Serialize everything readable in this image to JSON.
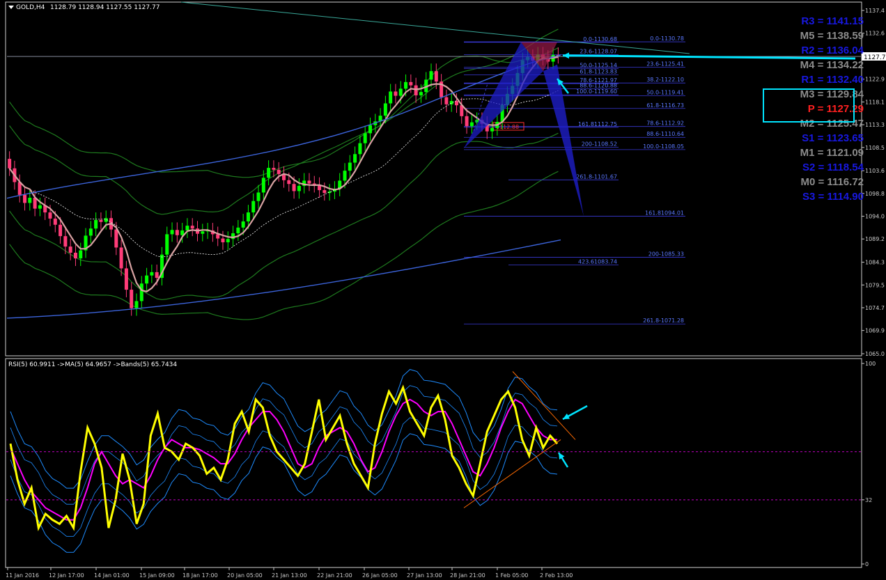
{
  "header": {
    "symbol": "GOLD,H4",
    "ohlc": "1128.79 1128.94 1127.55 1127.77",
    "rsi_label": "RSI(5) 60.9911  ->MA(5) 64.9657  ->Bands(5) 65.7434"
  },
  "price_axis": {
    "ticks": [
      "1137.4",
      "1132.6",
      "1127.7",
      "1122.9",
      "1118.1",
      "1113.3",
      "1108.5",
      "1103.6",
      "1098.8",
      "1094.0",
      "1089.2",
      "1084.3",
      "1079.5",
      "1074.7",
      "1069.9",
      "1065.0"
    ],
    "current": "1127.7"
  },
  "rsi_axis": {
    "ticks": [
      "100",
      "32",
      "0"
    ]
  },
  "time_axis": {
    "ticks": [
      "11 Jan 2016",
      "12 Jan 17:00",
      "14 Jan 01:00",
      "15 Jan 09:00",
      "18 Jan 17:00",
      "20 Jan 05:00",
      "21 Jan 13:00",
      "22 Jan 21:00",
      "26 Jan 05:00",
      "27 Jan 13:00",
      "28 Jan 21:00",
      "1 Feb 05:00",
      "2 Feb 13:00"
    ]
  },
  "pivots": [
    {
      "label": "R3 = 1141.15",
      "color": "#1818e0"
    },
    {
      "label": "M5 = 1138.59",
      "color": "#8c8c8c"
    },
    {
      "label": "R2 = 1136.04",
      "color": "#1818e0"
    },
    {
      "label": "M4 = 1134.22",
      "color": "#8c8c8c"
    },
    {
      "label": "R1 = 1132.40",
      "color": "#1818e0"
    },
    {
      "label": "M3 = 1129.84",
      "color": "#8c8c8c"
    },
    {
      "label": "P  = 1127.29",
      "color": "#ff2020"
    },
    {
      "label": "M2 = 1125.47",
      "color": "#8c8c8c"
    },
    {
      "label": "S1 = 1123.65",
      "color": "#1818e0"
    },
    {
      "label": "M1 = 1121.09",
      "color": "#8c8c8c"
    },
    {
      "label": "S2 = 1118.54",
      "color": "#1818e0"
    },
    {
      "label": "M0 = 1116.72",
      "color": "#8c8c8c"
    },
    {
      "label": "S3 = 1114.90",
      "color": "#1818e0"
    }
  ],
  "fib_labels": {
    "left": [
      "0.0-1130.68",
      "23.6-1128.07",
      "50.0-1125.14",
      "61.8-1123.83",
      "78.6-1121.97",
      "88.6-1120.88",
      "100.0-1119.60",
      "161.81112.75",
      "200-1108.52",
      "261.8-1101.67",
      "161.81094.01",
      "423.61083.74"
    ],
    "right": [
      "0.0-1130.78",
      "23.6-1125.41",
      "38.2-1122.10",
      "50.0-1119.41",
      "61.8-1116.73",
      "78.6-1112.92",
      "88.6-1110.64",
      "100.0-1108.05",
      "200-1085.33",
      "261.8-1071.28"
    ],
    "box": "1112.88"
  },
  "colors": {
    "bull": "#00ff00",
    "bear": "#ff3c78",
    "rsi": "#ffff00",
    "rsi_ma": "#ff00ff",
    "bands": "#1e8cff",
    "pivot_box": "#00e5ff"
  },
  "chart_data": [
    {
      "type": "candlestick",
      "title": "GOLD,H4",
      "ylim": [
        1065.0,
        1137.4
      ],
      "x_ticks": [
        "11 Jan 2016",
        "12 Jan 17:00",
        "14 Jan 01:00",
        "15 Jan 09:00",
        "18 Jan 17:00",
        "20 Jan 05:00",
        "21 Jan 13:00",
        "22 Jan 21:00",
        "26 Jan 05:00",
        "27 Jan 13:00",
        "28 Jan 21:00",
        "1 Feb 05:00",
        "2 Feb 13:00"
      ],
      "close": [
        1104.1,
        1101.2,
        1098.5,
        1096.8,
        1097.9,
        1095.6,
        1096.3,
        1094.8,
        1093.5,
        1092.2,
        1089.8,
        1087.6,
        1086.3,
        1085.1,
        1086.8,
        1089.9,
        1091.4,
        1093.2,
        1092.8,
        1093.6,
        1091.2,
        1087.4,
        1083.0,
        1078.5,
        1074.6,
        1076.1,
        1079.8,
        1081.5,
        1082.2,
        1081.0,
        1085.9,
        1090.2,
        1091.1,
        1090.0,
        1091.0,
        1092.0,
        1091.4,
        1090.3,
        1090.8,
        1091.0,
        1090.2,
        1089.3,
        1088.5,
        1089.2,
        1090.4,
        1091.6,
        1092.9,
        1094.8,
        1097.2,
        1099.0,
        1102.1,
        1104.2,
        1103.8,
        1102.9,
        1101.6,
        1100.8,
        1099.3,
        1100.4,
        1101.5,
        1100.9,
        1100.6,
        1099.5,
        1098.9,
        1099.2,
        1099.8,
        1101.5,
        1103.6,
        1105.3,
        1107.1,
        1109.4,
        1111.5,
        1113.2,
        1114.0,
        1115.2,
        1117.8,
        1120.3,
        1119.4,
        1120.9,
        1122.3,
        1121.6,
        1119.5,
        1120.2,
        1122.8,
        1124.6,
        1122.4,
        1119.1,
        1117.6,
        1118.3,
        1117.4,
        1115.1,
        1113.0,
        1113.8,
        1114.3,
        1113.5,
        1111.9,
        1112.6,
        1113.9,
        1117.5,
        1119.8,
        1121.5,
        1124.2,
        1126.9,
        1127.6,
        1126.8,
        1128.1,
        1127.4,
        1126.6,
        1128.0,
        1127.8
      ]
    },
    {
      "type": "line",
      "title": "RSI(5) 60.9911  ->MA(5) 64.9657  ->Bands(5) 65.7434",
      "ylim": [
        0,
        100
      ],
      "y_ticks": [
        100,
        32,
        0
      ],
      "series": [
        {
          "name": "RSI(5)",
          "values": [
            60,
            42,
            30,
            38,
            18,
            25,
            22,
            20,
            24,
            18,
            46,
            68,
            60,
            48,
            18,
            32,
            55,
            42,
            20,
            30,
            64,
            75,
            58,
            56,
            52,
            60,
            58,
            54,
            45,
            48,
            42,
            52,
            70,
            76,
            66,
            82,
            78,
            64,
            56,
            52,
            48,
            44,
            50,
            66,
            82,
            62,
            68,
            74,
            60,
            50,
            44,
            38,
            60,
            75,
            86,
            80,
            88,
            76,
            70,
            64,
            78,
            84,
            72,
            54,
            48,
            40,
            34,
            50,
            66,
            74,
            82,
            86,
            78,
            62,
            54,
            68,
            58,
            64,
            60
          ]
        },
        {
          "name": "MA(5)",
          "values": [
            58,
            50,
            42,
            36,
            32,
            28,
            26,
            24,
            22,
            22,
            28,
            38,
            50,
            56,
            50,
            44,
            40,
            42,
            40,
            38,
            44,
            52,
            58,
            62,
            60,
            58,
            58,
            57,
            55,
            53,
            50,
            50,
            55,
            62,
            68,
            72,
            76,
            76,
            72,
            66,
            58,
            50,
            48,
            50,
            58,
            64,
            66,
            68,
            66,
            60,
            52,
            46,
            48,
            56,
            66,
            74,
            80,
            82,
            80,
            76,
            74,
            76,
            76,
            70,
            62,
            54,
            46,
            44,
            50,
            58,
            68,
            76,
            82,
            80,
            74,
            68,
            64,
            62,
            62
          ]
        }
      ]
    }
  ]
}
